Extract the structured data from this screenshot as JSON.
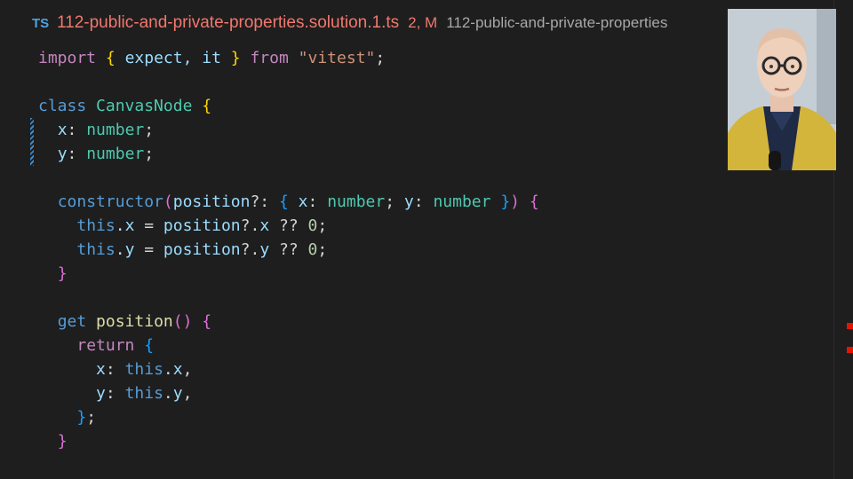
{
  "tab": {
    "icon": "TS",
    "filename": "112-public-and-private-properties.solution.1.ts",
    "status": "2, M",
    "breadcrumb": "112-public-and-private-properties"
  },
  "code": {
    "import_kw": "import",
    "import_names": "expect, it",
    "from_kw": "from",
    "module": "\"vitest\"",
    "class_kw": "class",
    "class_name": "CanvasNode",
    "prop_x": "x",
    "prop_y": "y",
    "type_number": "number",
    "ctor": "constructor",
    "param": "position",
    "this_kw": "this",
    "zero": "0",
    "get_kw": "get",
    "getter_name": "position",
    "return_kw": "return"
  },
  "colors": {
    "error_accent": "#f1786e",
    "scrollbar_error_marker": "#e51400"
  }
}
